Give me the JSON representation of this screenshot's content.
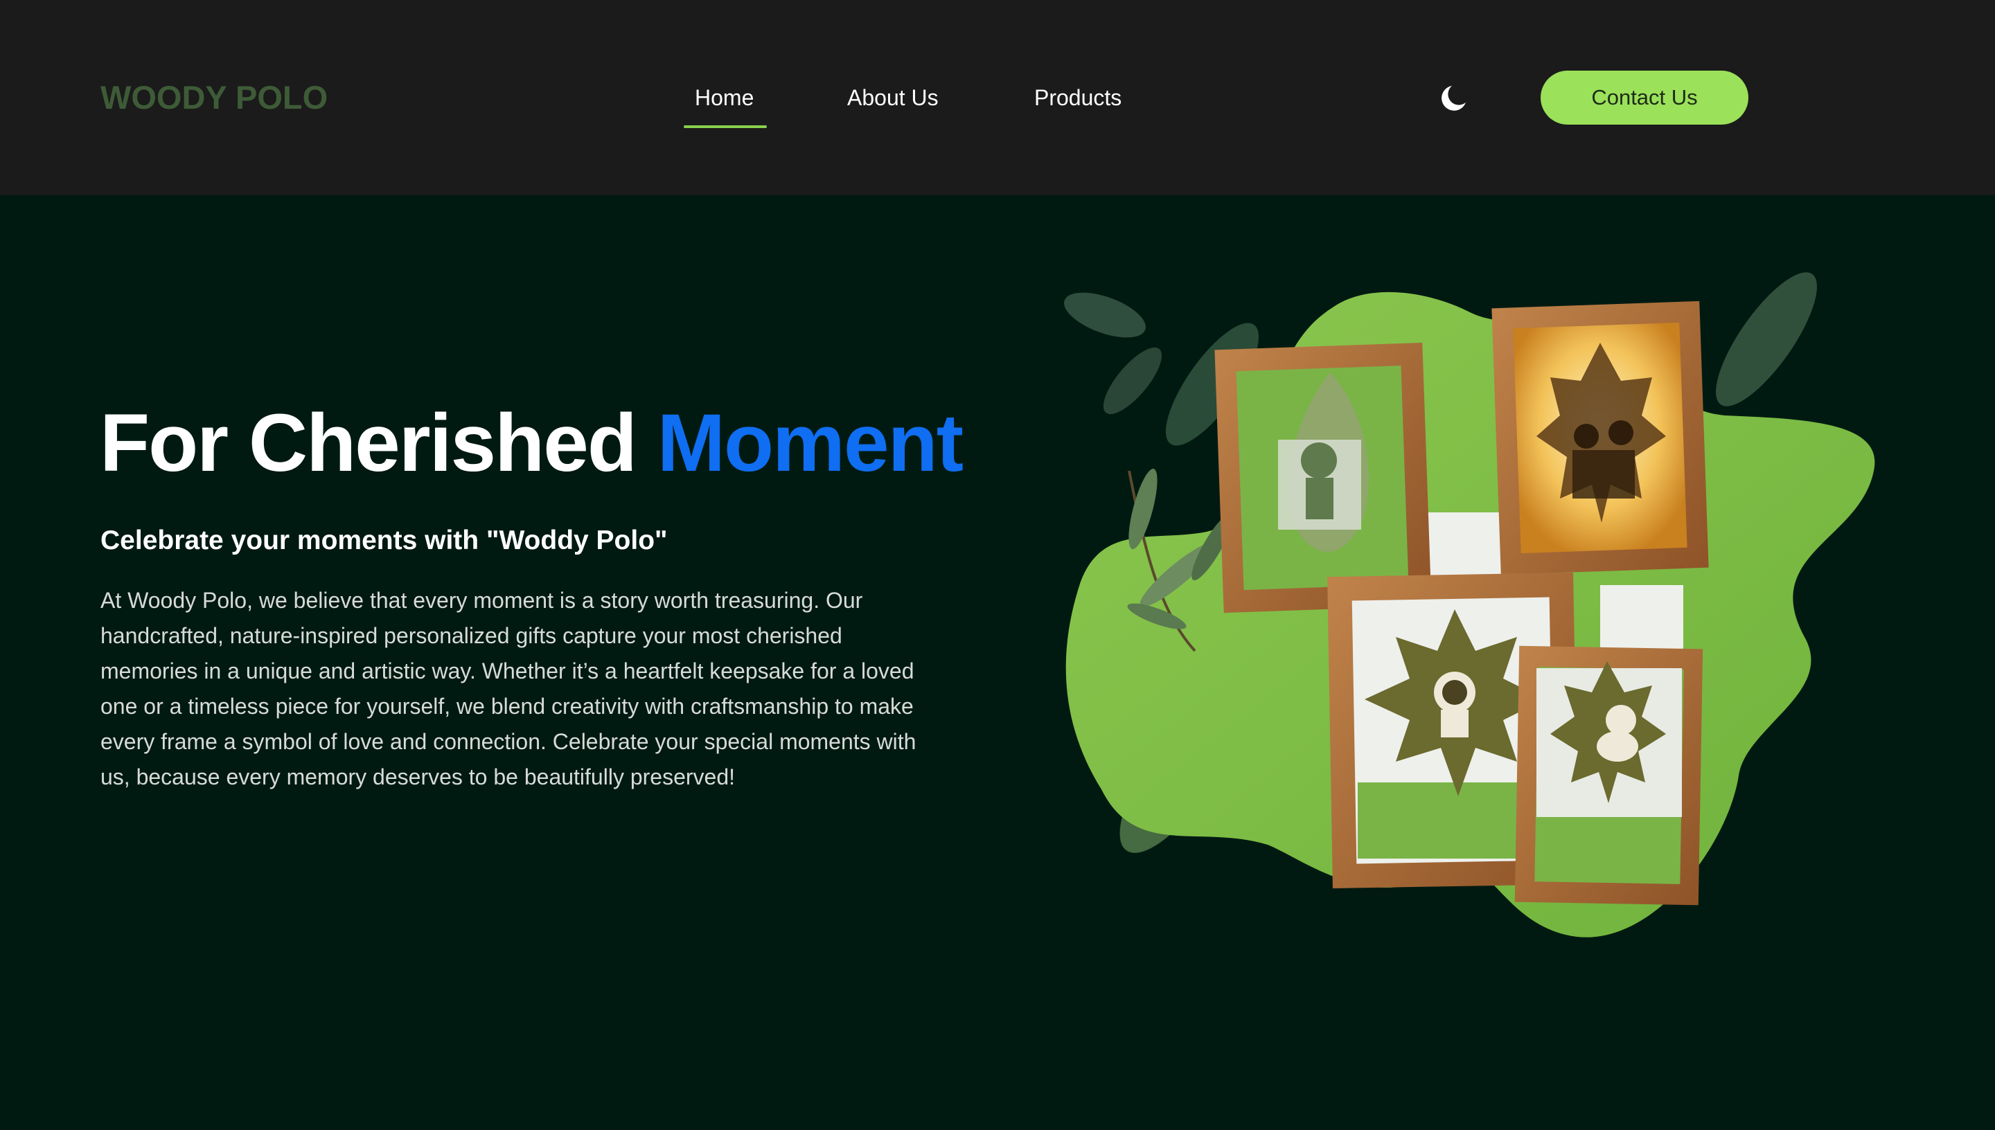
{
  "brand": {
    "logo_text": "WOODY POLO"
  },
  "nav": {
    "links": [
      {
        "label": "Home",
        "active": true
      },
      {
        "label": "About Us",
        "active": false
      },
      {
        "label": "Products",
        "active": false
      }
    ],
    "theme_icon": "moon-icon",
    "contact_label": "Contact Us"
  },
  "hero": {
    "title_main": "For Cherished ",
    "title_accent": "Moment",
    "subtitle": "Celebrate your moments with \"Woddy Polo\"",
    "body": "At Woody Polo, we believe that every moment is a story worth treasuring. Our handcrafted, nature-inspired personalized gifts capture your most cherished memories in a unique and artistic way. Whether it’s a heartfelt keepsake for a loved one or a timeless piece for yourself, we blend creativity with craftsmanship to make every frame a symbol of love and connection. Celebrate your special moments with us, because every memory deserves to be beautifully preserved!"
  },
  "colors": {
    "page_bg": "#011a11",
    "nav_bg": "#1b1b1b",
    "logo": "#3e5b37",
    "accent_blue": "#0f6ef2",
    "button_green": "#9be15a",
    "blob_green": "#7ec04a",
    "frame_wood": "#a86a35"
  },
  "hero_image": {
    "icon": "leaf-frames-illustration",
    "frames": [
      "leaf-portrait-frame",
      "lit-leaf-couple-frame",
      "maple-leaf-portrait-frame",
      "leaf-dog-frame"
    ]
  }
}
